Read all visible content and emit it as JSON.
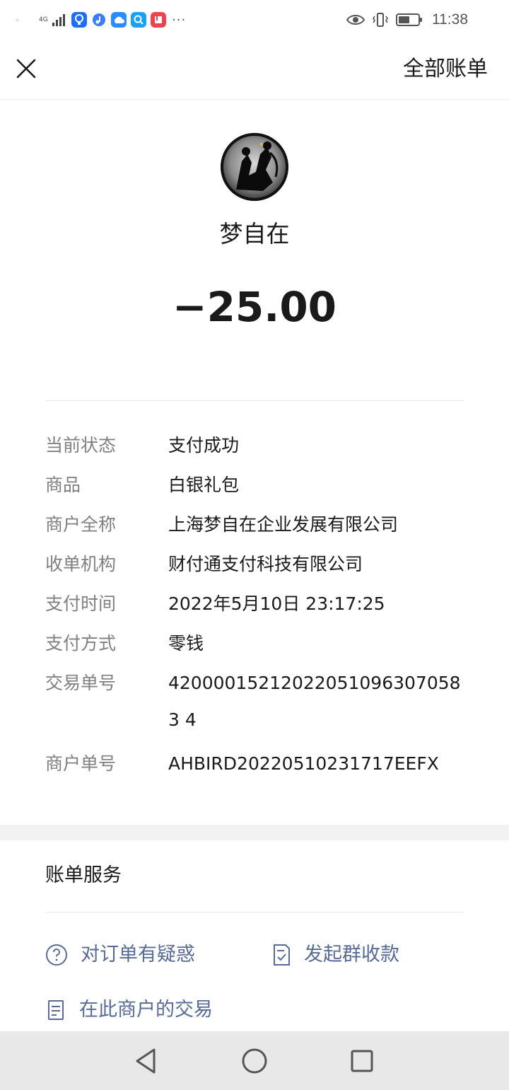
{
  "status_bar": {
    "network": "4G",
    "time": "11:38",
    "icons": [
      "signal-icon",
      "app-bulb-icon",
      "app-music-icon",
      "app-cloud-icon",
      "app-search-icon",
      "app-book-icon",
      "more-dots-icon",
      "eye-icon",
      "vibrate-icon",
      "battery-icon"
    ],
    "more": "···"
  },
  "header": {
    "close_icon": "close-icon",
    "all_bills_label": "全部账单"
  },
  "merchant": {
    "name": "梦自在",
    "amount": "−25.00"
  },
  "details": [
    {
      "key": "当前状态",
      "value": "支付成功"
    },
    {
      "key": "商品",
      "value": "白银礼包"
    },
    {
      "key": "商户全称",
      "value": "上海梦自在企业发展有限公司"
    },
    {
      "key": "收单机构",
      "value": "财付通支付科技有限公司"
    },
    {
      "key": "支付时间",
      "value": "2022年5月10日 23:17:25"
    },
    {
      "key": "支付方式",
      "value": "零钱"
    },
    {
      "key": "交易单号",
      "value": "420000152120220510963070583 4"
    },
    {
      "key": "商户单号",
      "value": "AHBIRD20220510231717EEFX"
    }
  ],
  "services": {
    "title": "账单服务",
    "order_question": "对订单有疑惑",
    "group_collect": "发起群收款",
    "merchant_transactions": "在此商户的交易"
  },
  "colors": {
    "link": "#576b95",
    "label_gray": "#808080",
    "nav_bar": "#e8e8e8"
  }
}
